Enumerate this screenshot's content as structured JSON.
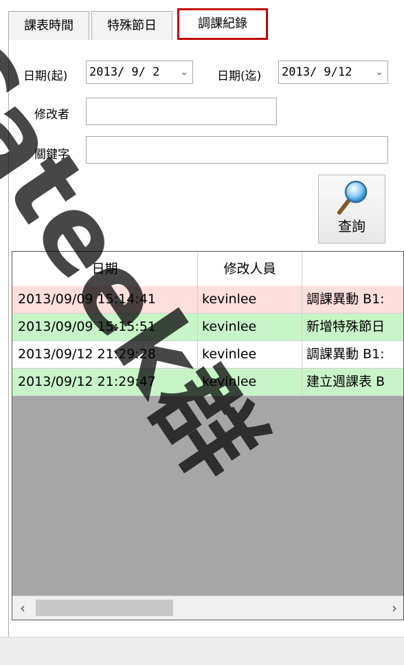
{
  "tabs": [
    "課表時間",
    "特殊節日",
    "調課紀錄"
  ],
  "filters": {
    "date_from_label": "日期(起)",
    "date_from_value": "2013/ 9/ 2",
    "date_to_label": "日期(迄)",
    "date_to_value": "2013/ 9/12",
    "modifier_label": "修改者",
    "modifier_value": "",
    "keyword_label": "關鍵字",
    "keyword_value": ""
  },
  "query_button_label": "查詢",
  "grid": {
    "columns": [
      "日期",
      "修改人員",
      ""
    ],
    "rows": [
      {
        "date": "2013/09/09 15:14:41",
        "user": "kevinlee",
        "desc": "調課異動 B1:",
        "color": "#ffdede"
      },
      {
        "date": "2013/09/09 15:15:51",
        "user": "kevinlee",
        "desc": "新增特殊節日",
        "color": "#c8f5c8"
      },
      {
        "date": "2013/09/12 21:29:28",
        "user": "kevinlee",
        "desc": "調課異動 B1:",
        "color": "#ffffff"
      },
      {
        "date": "2013/09/12 21:29:47",
        "user": "kevinlee",
        "desc": "建立週課表 B",
        "color": "#c8f5c8"
      }
    ]
  },
  "colors": {
    "highlight_border": "#c00000",
    "grid_empty": "#a6a6a6"
  },
  "watermark_text": "Cateek群"
}
